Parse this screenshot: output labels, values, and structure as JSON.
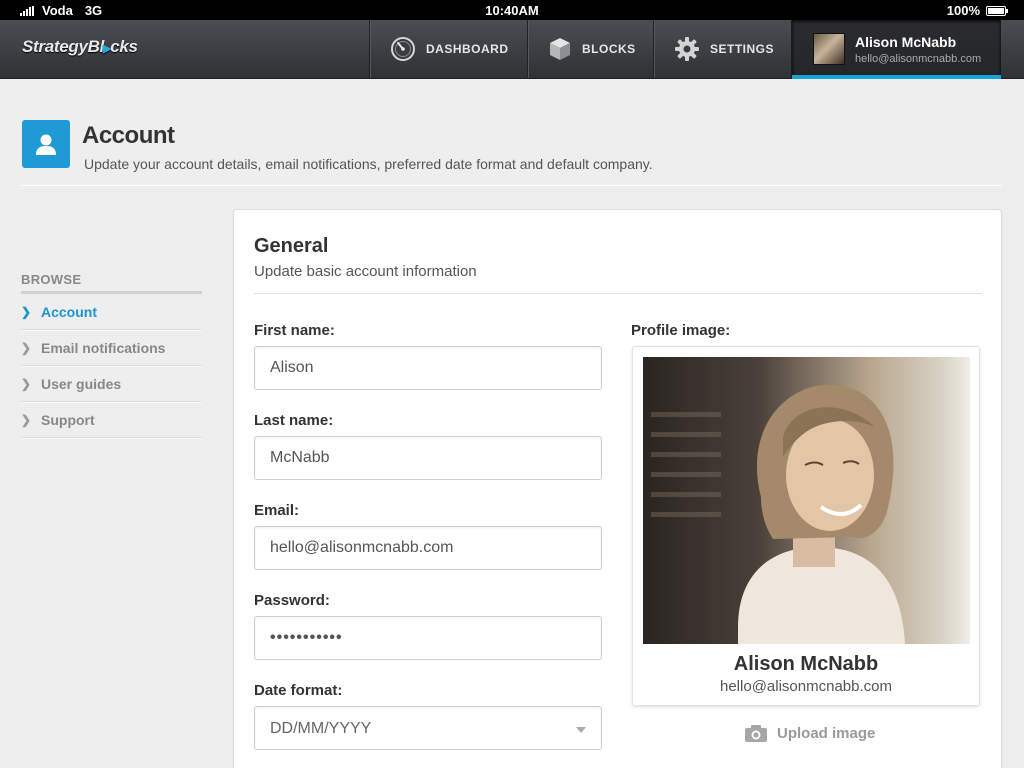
{
  "status_bar": {
    "carrier": "Voda",
    "network": "3G",
    "time": "10:40AM",
    "battery": "100%"
  },
  "nav": {
    "logo": {
      "part1": "Strategy",
      "part2": "Bl",
      "part3": "cks"
    },
    "items": [
      {
        "label": "DASHBOARD",
        "icon": "gauge-icon"
      },
      {
        "label": "BLOCKS",
        "icon": "cube-icon"
      },
      {
        "label": "SETTINGS",
        "icon": "gear-icon"
      }
    ],
    "user": {
      "name": "Alison McNabb",
      "email": "hello@alisonmcnabb.com"
    },
    "accent_color": "#1aa3d8"
  },
  "page": {
    "title": "Account",
    "subtitle": "Update your account details, email notifications, preferred date format and default company.",
    "icon": "user-icon"
  },
  "sidebar": {
    "title": "BROWSE",
    "items": [
      {
        "label": "Account",
        "active": true
      },
      {
        "label": "Email notifications",
        "active": false
      },
      {
        "label": "User guides",
        "active": false
      },
      {
        "label": "Support",
        "active": false
      }
    ]
  },
  "general": {
    "title": "General",
    "subtitle": "Update basic account information",
    "first_name": {
      "label": "First name:",
      "value": "Alison"
    },
    "last_name": {
      "label": "Last name:",
      "value": "McNabb"
    },
    "email": {
      "label": "Email:",
      "value": "hello@alisonmcnabb.com"
    },
    "password": {
      "label": "Password:",
      "value": "•••••••••••"
    },
    "date_format": {
      "label": "Date format:",
      "value": "DD/MM/YYYY"
    }
  },
  "profile": {
    "label": "Profile image:",
    "name": "Alison McNabb",
    "email": "hello@alisonmcnabb.com",
    "upload_label": "Upload image"
  }
}
